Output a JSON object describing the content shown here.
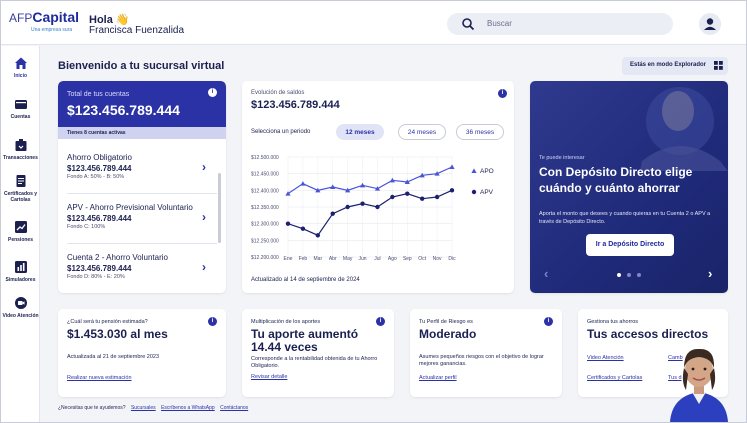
{
  "brand": {
    "afp": "AFP",
    "capital": "Capital",
    "line": "Una empresa sura"
  },
  "header": {
    "greeting": "Hola 👋",
    "user_name": "Francisca Fuenzalida",
    "search_placeholder": "Buscar"
  },
  "sidebar": {
    "items": [
      {
        "label": "Inicio",
        "icon": "home-icon"
      },
      {
        "label": "Cuentas",
        "icon": "wallet-icon"
      },
      {
        "label": "Transacciones",
        "icon": "transactions-icon"
      },
      {
        "label": "Certificados y Cartolas",
        "icon": "document-icon"
      },
      {
        "label": "Pensiones",
        "icon": "pension-chart-icon"
      },
      {
        "label": "Simuladores",
        "icon": "simulator-icon"
      },
      {
        "label": "Video Atención",
        "icon": "video-icon"
      }
    ]
  },
  "main": {
    "title": "Bienvenido a tu sucursal virtual",
    "explorer_mode": "Estás en modo Explorador"
  },
  "accounts": {
    "total_label": "Total de tus cuentas",
    "total_value": "$123.456.789.444",
    "active_count": "Tienes 8 cuentas activas",
    "items": [
      {
        "name": "Ahorro Obligatorio",
        "amount": "$123.456.789.444",
        "funds": "Fondo A: 50% - B: 50%"
      },
      {
        "name": "APV - Ahorro Previsional Voluntario",
        "amount": "$123.456.789.444",
        "funds": "Fondo C: 100%"
      },
      {
        "name": "Cuenta 2 - Ahorro Voluntario",
        "amount": "$123.456.789.444",
        "funds": "Fondo D: 80% - E: 20%"
      }
    ]
  },
  "balance": {
    "label": "Evolución de saldos",
    "value": "$123.456.789.444",
    "period_label": "Selecciona un periodo",
    "periods": [
      "12 meses",
      "24 meses",
      "36 meses"
    ],
    "updated": "Actualizado  al 14 de septiembre de 2024"
  },
  "chart_data": {
    "type": "line",
    "categories": [
      "Ene",
      "Feb",
      "Mar",
      "Abr",
      "May",
      "Jun",
      "Jul",
      "Ago",
      "Sep",
      "Oct",
      "Nov",
      "Dic"
    ],
    "y_tick_labels": [
      "$12.500.000",
      "$12.450.000",
      "$12.400.000",
      "$12.350.000",
      "$12.300.000",
      "$12.250.000",
      "$12.200.000"
    ],
    "ylim": [
      12200000,
      12500000
    ],
    "grid": true,
    "legend": "right",
    "series": [
      {
        "name": "APO",
        "color": "#4a55d6",
        "marker": "triangle",
        "values": [
          12390000,
          12420000,
          12400000,
          12410000,
          12400000,
          12415000,
          12405000,
          12430000,
          12425000,
          12445000,
          12450000,
          12470000
        ]
      },
      {
        "name": "APV",
        "color": "#1b2070",
        "marker": "circle",
        "values": [
          12300000,
          12285000,
          12265000,
          12330000,
          12350000,
          12360000,
          12350000,
          12380000,
          12390000,
          12375000,
          12380000,
          12400000
        ]
      }
    ]
  },
  "promo": {
    "eyebrow": "Te puede interesar",
    "title": "Con Depósito Directo elige cuándo y cuánto ahorrar",
    "body": "Aporta el monto que desees y cuando quieras en tu Cuenta 2 o APV a través de Depósito Directo.",
    "button": "Ir a Depósito Directo"
  },
  "pension": {
    "label": "¿Cuál será tu pensión estimada?",
    "value": "$1.453.030 al mes",
    "updated": "Actualizada al 21 de septiembre 2023",
    "link": "Realizar nueva estimación"
  },
  "contributions": {
    "label": "Multiplicación de los aportes",
    "title": "Tu aporte aumentó 14.44 veces",
    "text": "Corresponde a la rentabilidad obtenida de tu Ahorro Obligatorio.",
    "link": "Revisar detalle"
  },
  "risk": {
    "label": "Tu Perfil de Riesgo es",
    "title": "Moderado",
    "text": "Asumes pequeños riesgos con el objetivo de lograr mejores ganancias.",
    "link": "Actualizar perfil"
  },
  "shortcuts": {
    "label": "Gestiona tus ahorros",
    "title": "Tus accesos directos",
    "links": [
      "Video Atención",
      "Camb",
      "Certificados y Cartolas",
      "Tus d"
    ]
  },
  "footer": {
    "question": "¿Necesitas que te ayudemos?",
    "links": [
      "Sucursales",
      "Escríbenos a WhatsApp",
      "Contáctanos"
    ]
  }
}
